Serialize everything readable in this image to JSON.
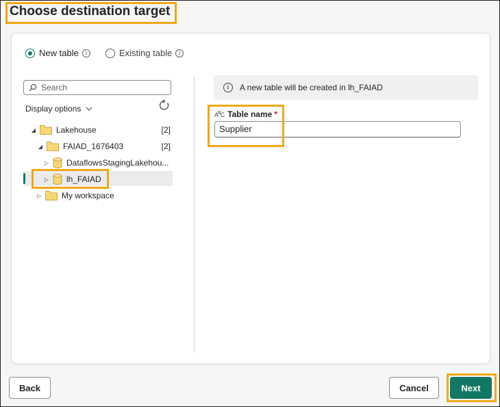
{
  "dialog": {
    "title": "Choose destination target"
  },
  "mode": {
    "new_table_label": "New table",
    "existing_table_label": "Existing table",
    "selected": "New table"
  },
  "navigator": {
    "search_placeholder": "Search",
    "display_options_label": "Display options",
    "tree": [
      {
        "label": "Lakehouse",
        "count": "[2]",
        "expanded": true,
        "icon": "folder-icon"
      },
      {
        "label": "FAIAD_1676403",
        "count": "[2]",
        "expanded": true,
        "icon": "folder-icon"
      },
      {
        "label": "DataflowsStagingLakehou...",
        "expanded": false,
        "icon": "database-icon"
      },
      {
        "label": "lh_FAIAD",
        "expanded": false,
        "icon": "database-icon",
        "selected": true
      },
      {
        "label": "My workspace",
        "expanded": false,
        "icon": "folder-icon"
      }
    ]
  },
  "details": {
    "info_message": "A new table will be created in lh_FAIAD",
    "table_name_label": "Table name",
    "required_marker": "*",
    "table_name_value": "Supplier"
  },
  "footer": {
    "back_label": "Back",
    "cancel_label": "Cancel",
    "next_label": "Next"
  },
  "colors": {
    "accent": "#117865",
    "highlight": "#f0a818",
    "folder": "#f8d775"
  }
}
